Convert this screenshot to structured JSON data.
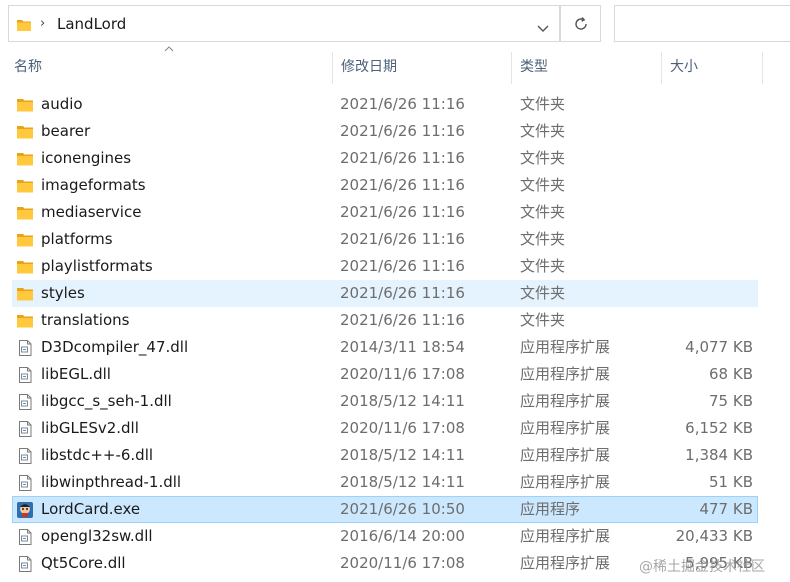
{
  "address_bar": {
    "path": "LandLord"
  },
  "columns": {
    "name": "名称",
    "date": "修改日期",
    "type": "类型",
    "size": "大小"
  },
  "colors": {
    "folder": "#ffc83d",
    "folder_dark": "#e8a317",
    "hover": "#e5f3ff",
    "selected": "#cce8ff"
  },
  "files": [
    {
      "name": "audio",
      "date": "2021/6/26 11:16",
      "type": "文件夹",
      "size": "",
      "icon": "folder-icon"
    },
    {
      "name": "bearer",
      "date": "2021/6/26 11:16",
      "type": "文件夹",
      "size": "",
      "icon": "folder-icon"
    },
    {
      "name": "iconengines",
      "date": "2021/6/26 11:16",
      "type": "文件夹",
      "size": "",
      "icon": "folder-icon"
    },
    {
      "name": "imageformats",
      "date": "2021/6/26 11:16",
      "type": "文件夹",
      "size": "",
      "icon": "folder-icon"
    },
    {
      "name": "mediaservice",
      "date": "2021/6/26 11:16",
      "type": "文件夹",
      "size": "",
      "icon": "folder-icon"
    },
    {
      "name": "platforms",
      "date": "2021/6/26 11:16",
      "type": "文件夹",
      "size": "",
      "icon": "folder-icon"
    },
    {
      "name": "playlistformats",
      "date": "2021/6/26 11:16",
      "type": "文件夹",
      "size": "",
      "icon": "folder-icon"
    },
    {
      "name": "styles",
      "date": "2021/6/26 11:16",
      "type": "文件夹",
      "size": "",
      "icon": "folder-icon",
      "state": "hover"
    },
    {
      "name": "translations",
      "date": "2021/6/26 11:16",
      "type": "文件夹",
      "size": "",
      "icon": "folder-icon"
    },
    {
      "name": "D3Dcompiler_47.dll",
      "date": "2014/3/11 18:54",
      "type": "应用程序扩展",
      "size": "4,077 KB",
      "icon": "dll-icon"
    },
    {
      "name": "libEGL.dll",
      "date": "2020/11/6 17:08",
      "type": "应用程序扩展",
      "size": "68 KB",
      "icon": "dll-icon"
    },
    {
      "name": "libgcc_s_seh-1.dll",
      "date": "2018/5/12 14:11",
      "type": "应用程序扩展",
      "size": "75 KB",
      "icon": "dll-icon"
    },
    {
      "name": "libGLESv2.dll",
      "date": "2020/11/6 17:08",
      "type": "应用程序扩展",
      "size": "6,152 KB",
      "icon": "dll-icon"
    },
    {
      "name": "libstdc++-6.dll",
      "date": "2018/5/12 14:11",
      "type": "应用程序扩展",
      "size": "1,384 KB",
      "icon": "dll-icon"
    },
    {
      "name": "libwinpthread-1.dll",
      "date": "2018/5/12 14:11",
      "type": "应用程序扩展",
      "size": "51 KB",
      "icon": "dll-icon"
    },
    {
      "name": "LordCard.exe",
      "date": "2021/6/26 10:50",
      "type": "应用程序",
      "size": "477 KB",
      "icon": "app-icon",
      "state": "selected"
    },
    {
      "name": "opengl32sw.dll",
      "date": "2016/6/14 20:00",
      "type": "应用程序扩展",
      "size": "20,433 KB",
      "icon": "dll-icon"
    },
    {
      "name": "Qt5Core.dll",
      "date": "2020/11/6 17:08",
      "type": "应用程序扩展",
      "size": "5,995 KB",
      "icon": "dll-icon"
    }
  ],
  "watermark": "@稀土掘金技术社区"
}
